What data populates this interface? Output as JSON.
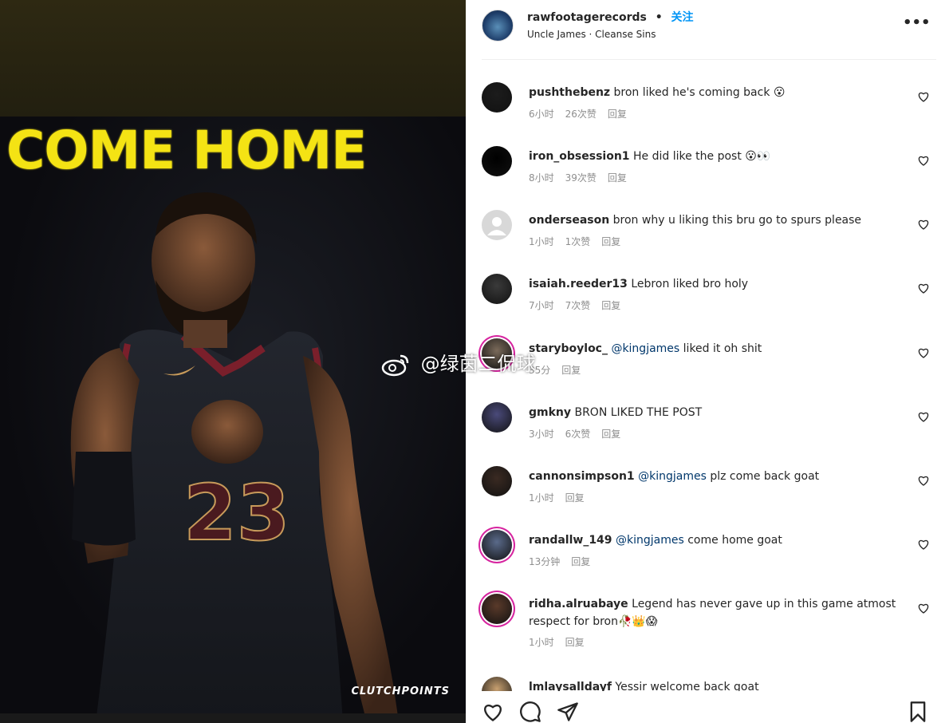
{
  "photo": {
    "headline": "COME HOME",
    "jersey_number": "23",
    "brand": "CLUTCHPOINTS"
  },
  "header": {
    "username": "rawfootagerecords",
    "separator": "•",
    "follow_label": "关注",
    "audio": "Uncle James · Cleanse Sins",
    "more_icon": "more-options-icon"
  },
  "comments": [
    {
      "user": "pushthebenz",
      "mention": "",
      "text": "bron liked he's coming back 😮",
      "time": "6小时",
      "likes": "26次赞",
      "reply": "回复",
      "avatar_color": "#1c1c1c",
      "ring": false
    },
    {
      "user": "iron_obsession1",
      "mention": "",
      "text": "He did like the post 😮👀",
      "time": "8小时",
      "likes": "39次赞",
      "reply": "回复",
      "avatar_color": "#000000",
      "ring": false
    },
    {
      "user": "onderseason",
      "mention": "",
      "text": "bron why u liking this bru go to spurs please",
      "time": "1小时",
      "likes": "1次赞",
      "reply": "回复",
      "avatar_color": "#d8d8d8",
      "ring": false
    },
    {
      "user": "isaiah.reeder13",
      "mention": "",
      "text": "Lebron liked bro holy",
      "time": "7小时",
      "likes": "7次赞",
      "reply": "回复",
      "avatar_color": "#3a3a3a",
      "ring": false
    },
    {
      "user": "staryboyloc_",
      "mention": "@kingjames",
      "text": "liked it oh shit",
      "time": "35分",
      "likes": "",
      "reply": "回复",
      "avatar_color": "#7a6a5a",
      "ring": true
    },
    {
      "user": "gmkny",
      "mention": "",
      "text": "BRON LIKED THE POST",
      "time": "3小时",
      "likes": "6次赞",
      "reply": "回复",
      "avatar_color": "#4a4a7a",
      "ring": false
    },
    {
      "user": "cannonsimpson1",
      "mention": "@kingjames",
      "text": "plz come back goat",
      "time": "1小时",
      "likes": "",
      "reply": "回复",
      "avatar_color": "#3a2a22",
      "ring": false
    },
    {
      "user": "randallw_149",
      "mention": "@kingjames",
      "text": "come home goat",
      "time": "13分钟",
      "likes": "",
      "reply": "回复",
      "avatar_color": "#5a6a8a",
      "ring": true
    },
    {
      "user": "ridha.alruabaye",
      "mention": "",
      "text": "Legend has never gave up in this game atmost respect for bron🥀👑😱",
      "time": "1小时",
      "likes": "",
      "reply": "回复",
      "avatar_color": "#5a3a2a",
      "ring": true
    },
    {
      "user": "lmlaysalldayf",
      "mention": "",
      "text": "Yessir welcome back goat",
      "time": "",
      "likes": "",
      "reply": "",
      "avatar_color": "#c8a070",
      "ring": false
    }
  ],
  "actions": {
    "like_icon": "heart-icon",
    "comment_icon": "comment-icon",
    "share_icon": "share-icon",
    "save_icon": "bookmark-icon"
  },
  "watermark": {
    "text": "@绿茵二侃球"
  },
  "colors": {
    "headline": "#f4e314",
    "link": "#0095f6",
    "mention": "#00376b",
    "meta": "#8e8e8e",
    "ring": "#d6249f"
  }
}
